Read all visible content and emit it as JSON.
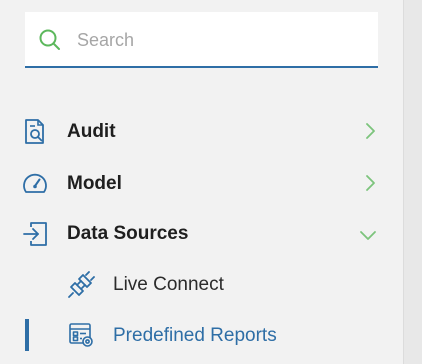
{
  "search": {
    "placeholder": "Search"
  },
  "nav": {
    "items": [
      {
        "label": "Audit",
        "icon": "audit-icon",
        "expand_icon": "chevron-right-icon"
      },
      {
        "label": "Model",
        "icon": "model-gauge-icon",
        "expand_icon": "chevron-right-icon"
      },
      {
        "label": "Data Sources",
        "icon": "data-sources-icon",
        "expand_icon": "chevron-down-icon",
        "children": [
          {
            "label": "Live Connect",
            "icon": "live-connect-plug-icon"
          },
          {
            "label": "Predefined Reports",
            "icon": "predefined-reports-icon",
            "active": true
          }
        ]
      }
    ]
  },
  "colors": {
    "accent": "#2e6ea6",
    "search_icon": "#5cb85c",
    "chevron": "#7cc47c",
    "background": "#f2f2f2"
  }
}
